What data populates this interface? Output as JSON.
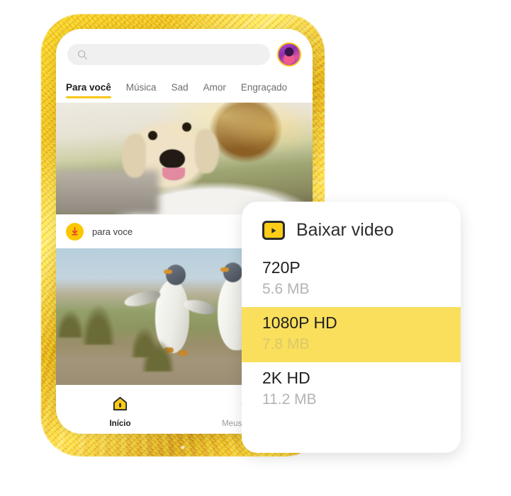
{
  "phone": {
    "search": {
      "placeholder": "",
      "value": "",
      "icon": "search-icon"
    },
    "avatar_alt": "user-avatar",
    "tabs": [
      {
        "label": "Para você",
        "active": true
      },
      {
        "label": "Música",
        "active": false
      },
      {
        "label": "Sad",
        "active": false
      },
      {
        "label": "Amor",
        "active": false
      },
      {
        "label": "Engraçado",
        "active": false
      }
    ],
    "feed_item": {
      "label": "para voce",
      "badge_icon": "download-arrow-icon",
      "action_icon": "download-icon"
    },
    "bottom_nav": [
      {
        "label": "Início",
        "icon": "home-icon",
        "active": true
      },
      {
        "label": "Meus arquivos",
        "icon": "my-files-icon",
        "active": false
      }
    ]
  },
  "download_card": {
    "title": "Baixar video",
    "icon": "video-play-icon",
    "options": [
      {
        "quality": "720P",
        "size": "5.6 MB",
        "selected": false
      },
      {
        "quality": "1080P HD",
        "size": "7.8 MB",
        "selected": true
      },
      {
        "quality": "2K HD",
        "size": "11.2 MB",
        "selected": false
      }
    ]
  },
  "colors": {
    "accent_yellow": "#FADF5C",
    "badge_yellow": "#FBC800",
    "tab_underline": "#F7C71A",
    "glow_gold": "#F7D01A",
    "text_dark": "#1F1F1F",
    "text_muted": "#B3B3B3"
  }
}
